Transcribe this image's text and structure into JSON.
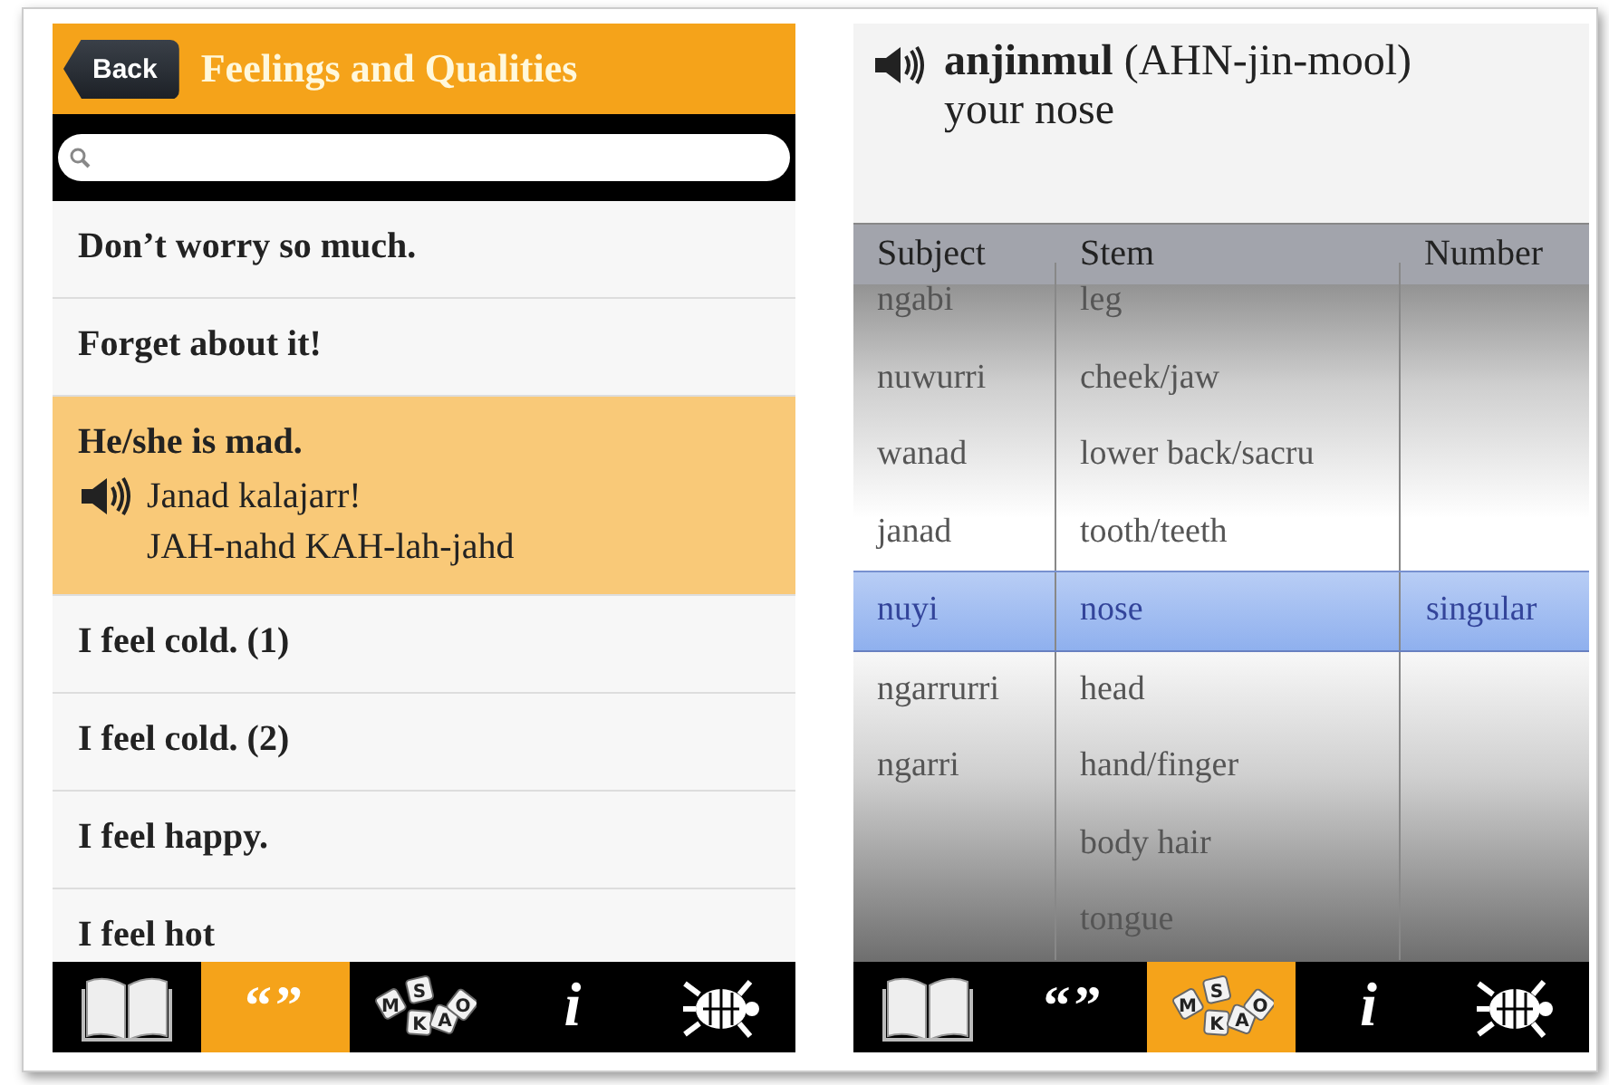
{
  "left_screen": {
    "back_button": "Back",
    "title": "Feelings and Qualities",
    "phrases": [
      {
        "text": "Don’t worry so much.",
        "selected": false
      },
      {
        "text": "Forget about it!",
        "selected": false
      },
      {
        "text": "He/she is mad.",
        "selected": true,
        "translation": "Janad kalajarr!",
        "pronunciation": "JAH-nahd KAH-lah-jahd"
      },
      {
        "text": "I feel cold. (1)",
        "selected": false
      },
      {
        "text": "I feel cold. (2)",
        "selected": false
      },
      {
        "text": "I feel happy.",
        "selected": false
      },
      {
        "text": "I feel hot",
        "selected": false
      }
    ],
    "tab_bar": [
      {
        "kind": "book",
        "selected": false
      },
      {
        "kind": "quotes",
        "label": "“”",
        "selected": true
      },
      {
        "kind": "tiles",
        "letters": [
          "M",
          "S",
          "K",
          "A",
          "O"
        ],
        "selected": false
      },
      {
        "kind": "info",
        "label": "i",
        "selected": false
      },
      {
        "kind": "turtle",
        "selected": false
      }
    ]
  },
  "right_screen": {
    "word": "**anjinmul** (AHN-jin-mool)",
    "meaning": "your nose",
    "columns": [
      "Subject",
      "Stem",
      "Number"
    ],
    "rows": [
      {
        "subject": "ngabi",
        "stem": "leg",
        "selected": false
      },
      {
        "subject": "nuwurri",
        "stem": "cheek/jaw",
        "selected": false
      },
      {
        "subject": "wanad",
        "stem": "lower back/sacru",
        "selected": false
      },
      {
        "subject": "janad",
        "stem": "tooth/teeth",
        "selected": false
      },
      {
        "subject": "nuyi",
        "stem": "nose",
        "number": "singular",
        "selected": true
      },
      {
        "subject": "ngarrurri",
        "stem": "head",
        "selected": false
      },
      {
        "subject": "ngarri",
        "stem": "hand/finger",
        "selected": false
      },
      {
        "stem": "body hair",
        "selected": false
      },
      {
        "stem": "tongue",
        "selected": false
      }
    ],
    "tab_bar": [
      {
        "kind": "book",
        "selected": false
      },
      {
        "kind": "quotes",
        "label": "“”",
        "selected": false
      },
      {
        "kind": "tiles",
        "letters": [
          "M",
          "S",
          "K",
          "A",
          "O"
        ],
        "selected": true
      },
      {
        "kind": "info",
        "label": "i",
        "selected": false
      },
      {
        "kind": "turtle",
        "selected": false
      }
    ]
  }
}
